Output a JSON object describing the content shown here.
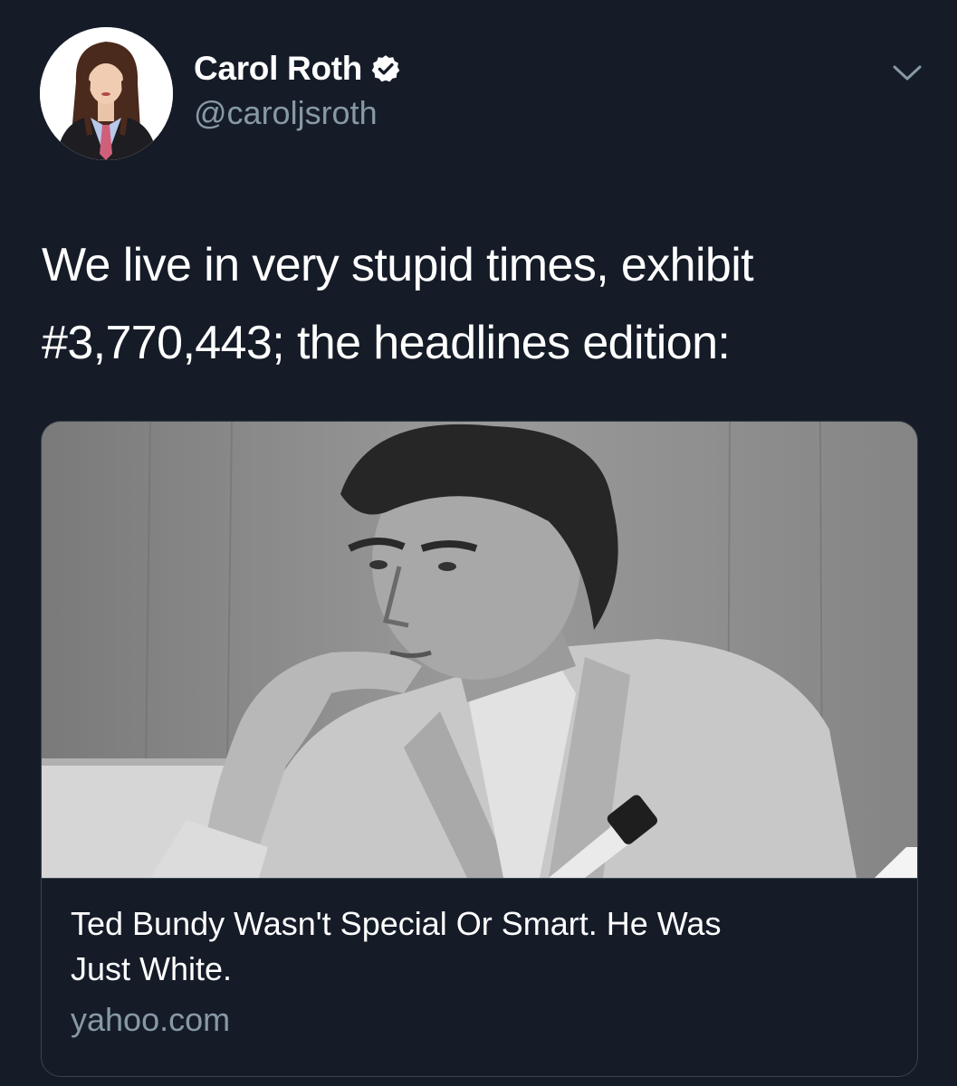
{
  "author": {
    "display_name": "Carol Roth",
    "handle": "@caroljsroth",
    "verified": true,
    "avatar_icon": "profile-photo"
  },
  "tweet": {
    "text_line1": "We live in very stupid times, exhibit",
    "text_line2": "#3,770,443; the headlines edition:"
  },
  "card": {
    "image_icon": "black-and-white-photo",
    "title_line1": "Ted Bundy Wasn't Special Or Smart. He Was",
    "title_line2": "Just White.",
    "domain": "yahoo.com"
  },
  "menu": {
    "caret_icon": "chevron-down-icon"
  },
  "colors": {
    "background": "#151c28",
    "text_primary": "#ffffff",
    "text_secondary": "#8899a6",
    "border": "#38444d"
  }
}
